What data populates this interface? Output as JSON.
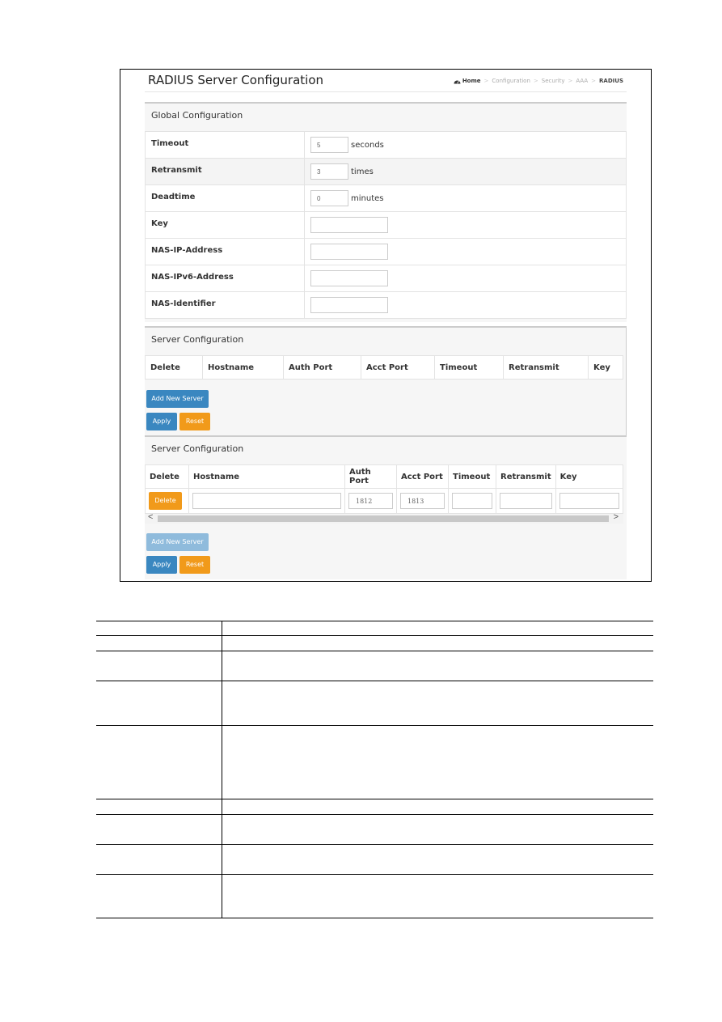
{
  "page": {
    "title": "RADIUS Server Configuration",
    "breadcrumb": {
      "home_icon": "dashboard-icon",
      "items": [
        "Home",
        "Configuration",
        "Security",
        "AAA",
        "RADIUS"
      ],
      "separator": ">"
    }
  },
  "global_configuration": {
    "title": "Global Configuration",
    "rows": [
      {
        "label": "Timeout",
        "value": "5",
        "unit": "seconds"
      },
      {
        "label": "Retransmit",
        "value": "3",
        "unit": "times"
      },
      {
        "label": "Deadtime",
        "value": "0",
        "unit": "minutes"
      },
      {
        "label": "Key",
        "value": "",
        "unit": ""
      },
      {
        "label": "NAS-IP-Address",
        "value": "",
        "unit": ""
      },
      {
        "label": "NAS-IPv6-Address",
        "value": "",
        "unit": ""
      },
      {
        "label": "NAS-Identifier",
        "value": "",
        "unit": ""
      }
    ]
  },
  "server_configuration_empty": {
    "title": "Server Configuration",
    "columns": [
      "Delete",
      "Hostname",
      "Auth Port",
      "Acct Port",
      "Timeout",
      "Retransmit",
      "Key"
    ],
    "add_button": "Add New Server",
    "apply_button": "Apply",
    "reset_button": "Reset"
  },
  "server_configuration_filled": {
    "title": "Server Configuration",
    "columns": [
      "Delete",
      "Hostname",
      "Auth Port",
      "Acct Port",
      "Timeout",
      "Retransmit",
      "Key"
    ],
    "rows": [
      {
        "delete_button": "Delete",
        "hostname": "",
        "auth_port": "1812",
        "acct_port": "1813",
        "timeout": "",
        "retransmit": "",
        "key": ""
      }
    ],
    "scroll_left": "<",
    "scroll_right": ">",
    "add_button": "Add New Server",
    "apply_button": "Apply",
    "reset_button": "Reset"
  },
  "colors": {
    "primary_button": "#3a87c0",
    "primary_button_disabled": "#8fbbdc",
    "warning_button": "#f19a1a"
  },
  "description_table": {
    "row_count": 10
  }
}
